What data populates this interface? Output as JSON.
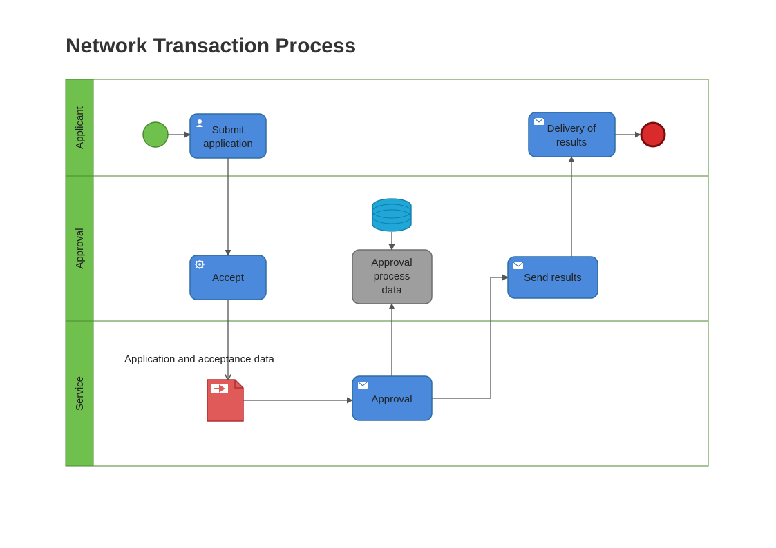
{
  "title": "Network Transaction Process",
  "lanes": {
    "l1": "Applicant",
    "l2": "Approval",
    "l3": "Service"
  },
  "tasks": {
    "submit1": "Submit",
    "submit2": "application",
    "accept": "Accept",
    "approval": "Approval",
    "approval_data1": "Approval",
    "approval_data2": "process",
    "approval_data3": "data",
    "send": "Send results",
    "delivery1": "Delivery of",
    "delivery2": "results"
  },
  "annotation": "Application and acceptance data",
  "colors": {
    "laneHeader": "#70C04E",
    "laneBorder": "#4A8A2C",
    "taskFill": "#4A89DC",
    "taskStroke": "#2E6DA4",
    "dataStore": "#20A7D8",
    "start": "#70C04E",
    "end": "#D92B2B",
    "grayTask": "#9E9E9E",
    "doc": "#E05A5A"
  }
}
